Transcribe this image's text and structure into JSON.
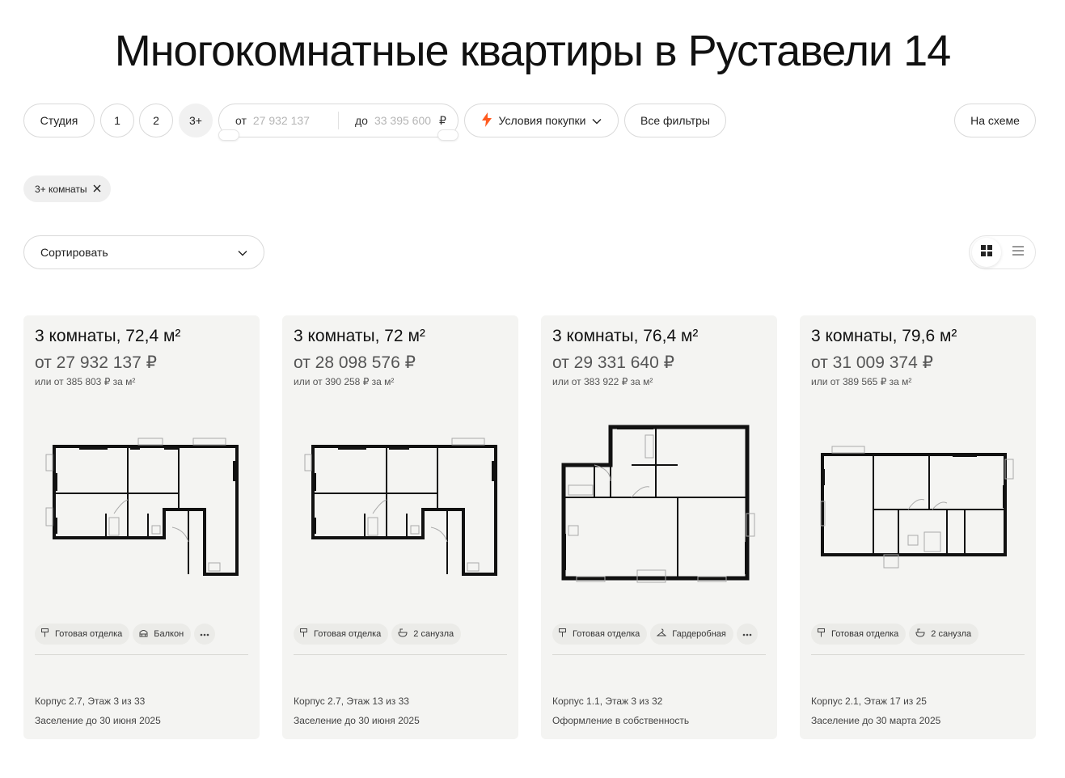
{
  "page": {
    "title": "Многокомнатные квартиры в Руставели 14"
  },
  "filters": {
    "rooms": [
      "Студия",
      "1",
      "2",
      "3+"
    ],
    "price": {
      "from_label": "от",
      "from_placeholder": "27 932 137",
      "to_label": "до",
      "to_placeholder": "33 395 600",
      "currency": "₽"
    },
    "purchase_terms": "Условия покупки",
    "all_filters": "Все фильтры",
    "on_map": "На схеме"
  },
  "active_chips": [
    {
      "label": "3+ комнаты"
    }
  ],
  "sort": {
    "label": "Сортировать"
  },
  "colors": {
    "accent": "#ff5a1f",
    "card_bg": "#f4f4f2"
  },
  "cards": [
    {
      "title": "3 комнаты, 72,4 м²",
      "price": "от 27 932 137 ₽",
      "price_per_m2": "или от 385 803 ₽ за м²",
      "tags": [
        {
          "icon": "paint-roller-icon",
          "label": "Готовая отделка"
        },
        {
          "icon": "balcony-icon",
          "label": "Балкон"
        }
      ],
      "meta_building": "Корпус 2.7, Этаж 3 из 33",
      "meta_move_in": "Заселение до 30 июня 2025"
    },
    {
      "title": "3 комнаты, 72 м²",
      "price": "от 28 098 576 ₽",
      "price_per_m2": "или от 390 258 ₽ за м²",
      "tags": [
        {
          "icon": "paint-roller-icon",
          "label": "Готовая отделка"
        },
        {
          "icon": "bathtub-icon",
          "label": "2 санузла"
        }
      ],
      "meta_building": "Корпус 2.7, Этаж 13 из 33",
      "meta_move_in": "Заселение до 30 июня 2025"
    },
    {
      "title": "3 комнаты, 76,4 м²",
      "price": "от 29 331 640 ₽",
      "price_per_m2": "или от 383 922 ₽ за м²",
      "tags": [
        {
          "icon": "paint-roller-icon",
          "label": "Готовая отделка"
        },
        {
          "icon": "hanger-icon",
          "label": "Гардеробная"
        }
      ],
      "meta_building": "Корпус 1.1, Этаж 3 из 32",
      "meta_move_in": "Оформление в собственность"
    },
    {
      "title": "3 комнаты, 79,6 м²",
      "price": "от 31 009 374 ₽",
      "price_per_m2": "или от 389 565 ₽ за м²",
      "tags": [
        {
          "icon": "paint-roller-icon",
          "label": "Готовая отделка"
        },
        {
          "icon": "bathtub-icon",
          "label": "2 санузла"
        }
      ],
      "meta_building": "Корпус 2.1, Этаж 17 из 25",
      "meta_move_in": "Заселение до 30 марта 2025"
    }
  ]
}
